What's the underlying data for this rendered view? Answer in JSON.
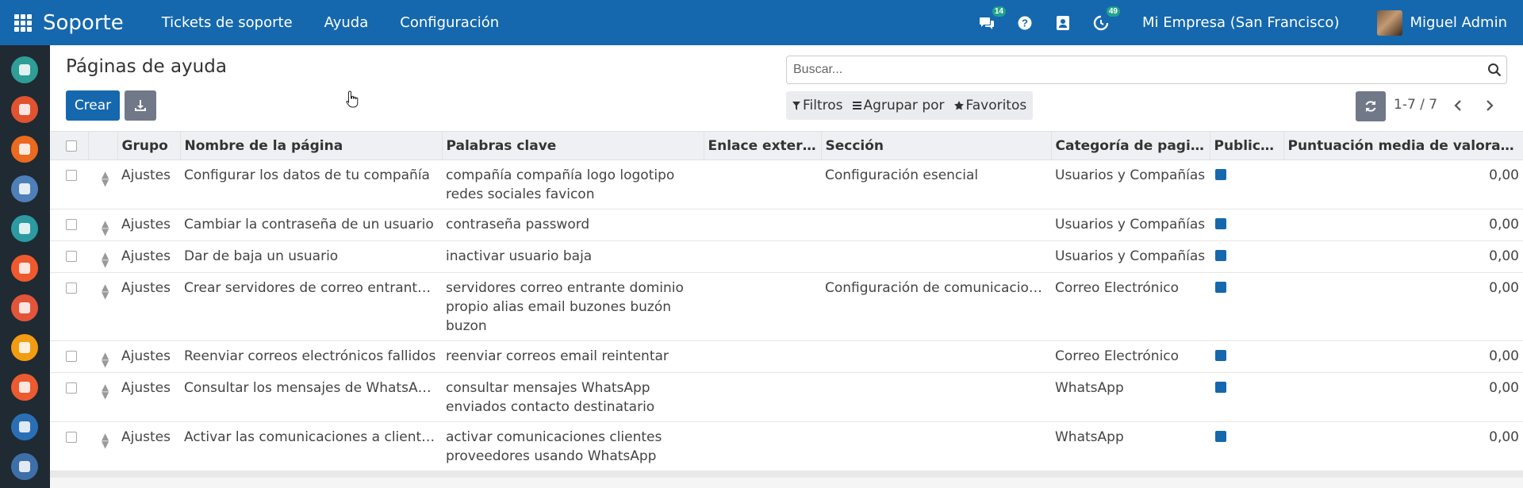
{
  "app": {
    "brand": "Soporte",
    "menu": [
      "Tickets de soporte",
      "Ayuda",
      "Configuración"
    ],
    "messages_count": "14",
    "activities_count": "49",
    "company": "Mi Empresa (San Francisco)",
    "user": "Miguel Admin"
  },
  "sidebar_colors": [
    "#2e9e96",
    "#e0532e",
    "#ea6a1f",
    "#4f7fb8",
    "#2c9aa1",
    "#ee5a2d",
    "#e2553a",
    "#f39c12",
    "#ec5b2f",
    "#2a6fb5",
    "#3e6fa8"
  ],
  "page": {
    "title": "Páginas de ayuda",
    "create_label": "Crear",
    "search_placeholder": "Buscar...",
    "filters_label": "Filtros",
    "group_by_label": "Agrupar por",
    "favorites_label": "Favoritos",
    "pager": "1-7 / 7"
  },
  "table": {
    "columns": [
      "Grupo",
      "Nombre de la página",
      "Palabras clave",
      "Enlace externo",
      "Sección",
      "Categoría de pagina",
      "Publica...",
      "Puntuación media de valoraciones"
    ],
    "rows": [
      {
        "group": "Ajustes",
        "name": "Configurar los datos de tu compañía",
        "keywords": "compañía compañía logo logotipo redes sociales favicon",
        "link": "",
        "section": "Configuración esencial",
        "category": "Usuarios y Compañías",
        "published": true,
        "rating": "0,00"
      },
      {
        "group": "Ajustes",
        "name": "Cambiar la contraseña de un usuario",
        "keywords": "contraseña password",
        "link": "",
        "section": "",
        "category": "Usuarios y Compañías",
        "published": true,
        "rating": "0,00"
      },
      {
        "group": "Ajustes",
        "name": "Dar de baja un usuario",
        "keywords": "inactivar usuario baja",
        "link": "",
        "section": "",
        "category": "Usuarios y Compañías",
        "published": true,
        "rating": "0,00"
      },
      {
        "group": "Ajustes",
        "name": "Crear servidores de correo entrante c...",
        "keywords": "servidores correo entrante dominio propio alias email buzones buzón buzon",
        "link": "",
        "section": "Configuración de comunicacion...",
        "category": "Correo Electrónico",
        "published": true,
        "rating": "0,00"
      },
      {
        "group": "Ajustes",
        "name": "Reenviar correos electrónicos fallidos",
        "keywords": "reenviar correos email reintentar",
        "link": "",
        "section": "",
        "category": "Correo Electrónico",
        "published": true,
        "rating": "0,00"
      },
      {
        "group": "Ajustes",
        "name": "Consultar los mensajes de WhatsApp ...",
        "keywords": "consultar mensajes WhatsApp enviados contacto destinatario",
        "link": "",
        "section": "",
        "category": "WhatsApp",
        "published": true,
        "rating": "0,00"
      },
      {
        "group": "Ajustes",
        "name": "Activar las comunicaciones a clientes ...",
        "keywords": "activar comunicaciones clientes proveedores usando WhatsApp",
        "link": "",
        "section": "",
        "category": "WhatsApp",
        "published": true,
        "rating": "0,00"
      }
    ]
  }
}
